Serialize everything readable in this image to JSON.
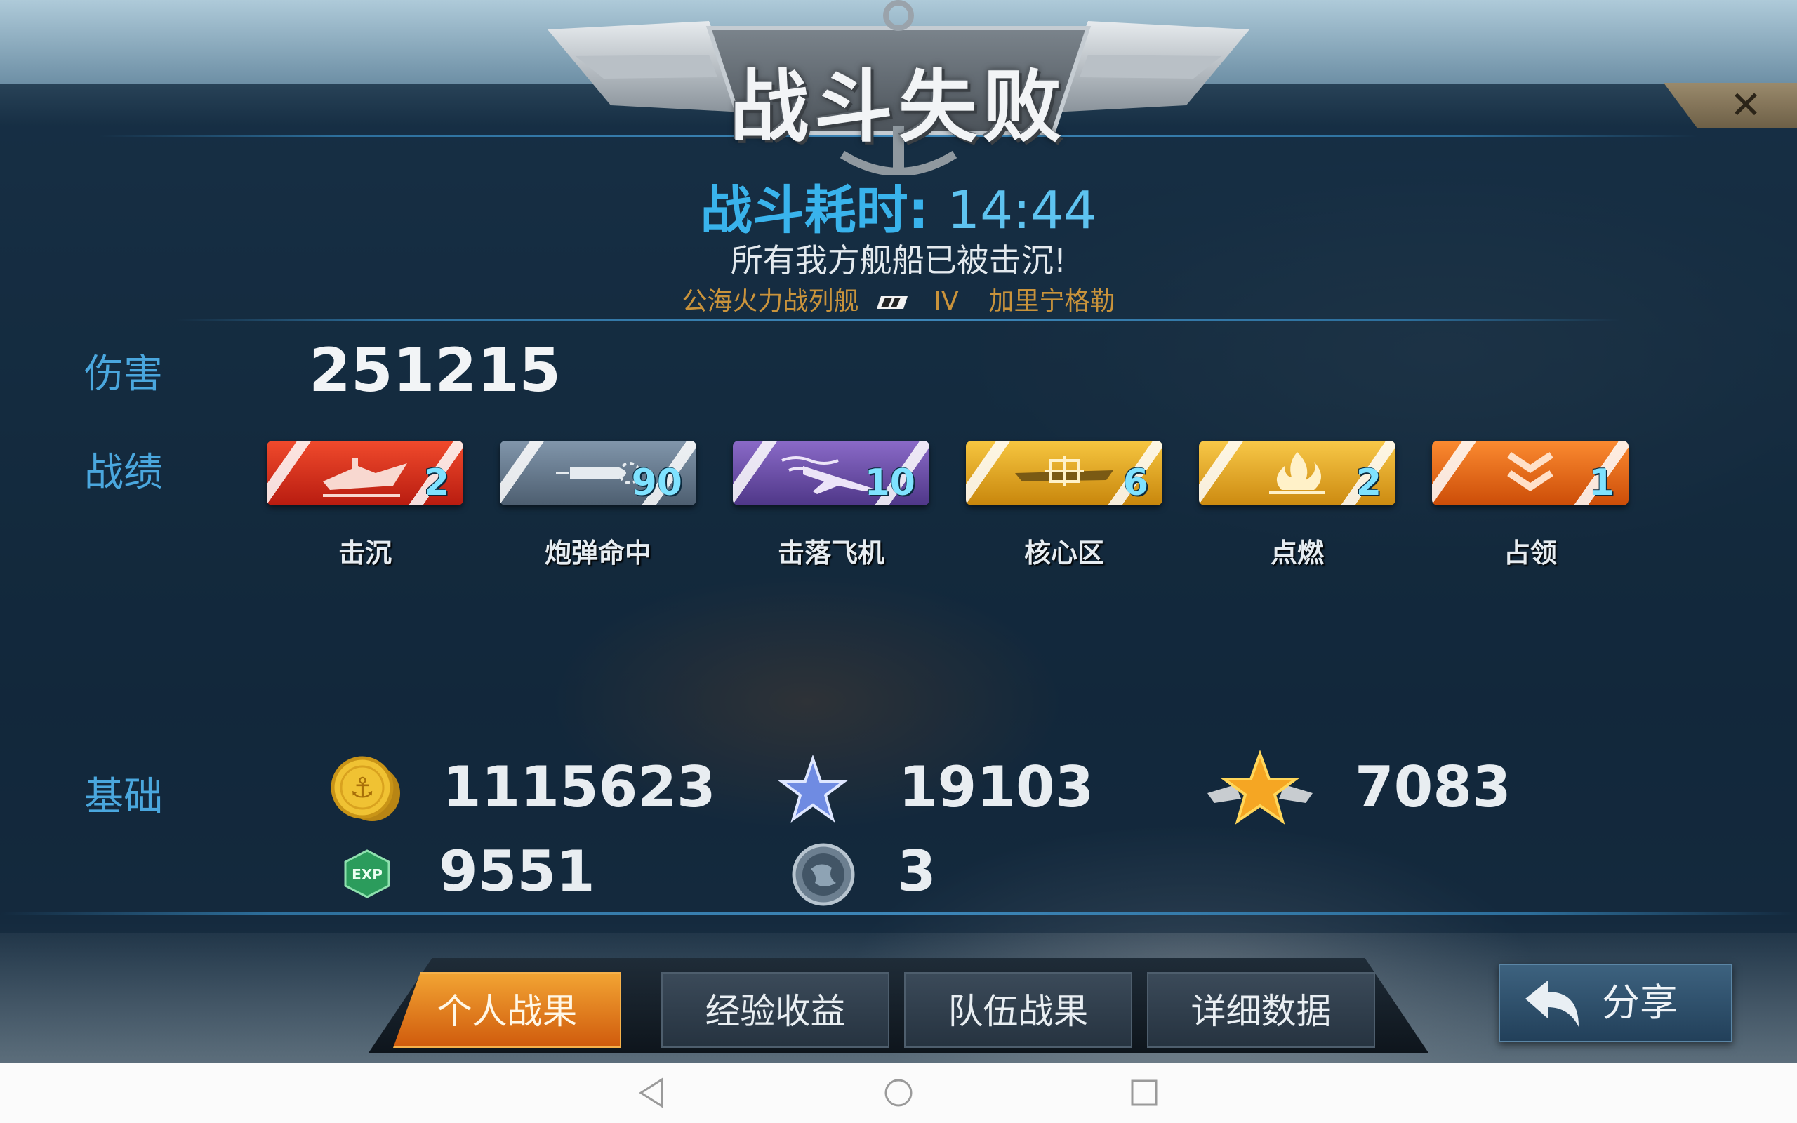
{
  "header": {
    "title": "战斗失败"
  },
  "battle": {
    "time_label": "战斗耗时:",
    "time_value": "14:44",
    "message": "所有我方舰船已被击沉!",
    "mode": "公海火力战列舰",
    "tier": "IV",
    "ship": "加里宁格勒"
  },
  "damage": {
    "label": "伤害",
    "value": "251215"
  },
  "record": {
    "label": "战绩",
    "items": [
      {
        "name": "击沉",
        "count": "2",
        "color": "#d62a1a",
        "icon": "sinking-ship-icon"
      },
      {
        "name": "炮弹命中",
        "count": "90",
        "color": "#5d6f83",
        "icon": "shell-icon"
      },
      {
        "name": "击落飞机",
        "count": "10",
        "color": "#6a4fa6",
        "icon": "plane-down-icon"
      },
      {
        "name": "核心区",
        "count": "6",
        "color": "#e0a41c",
        "icon": "citadel-icon"
      },
      {
        "name": "点燃",
        "count": "2",
        "color": "#e6a51f",
        "icon": "fire-icon"
      },
      {
        "name": "占领",
        "count": "1",
        "color": "#ec6b18",
        "icon": "capture-chevron-icon"
      }
    ]
  },
  "base": {
    "label": "基础",
    "silver": "1115623",
    "star_points": "19103",
    "medal_points": "7083",
    "exp": "9551",
    "globe": "3",
    "exp_icon_text": "EXP"
  },
  "tabs": [
    {
      "label": "个人战果",
      "active": true
    },
    {
      "label": "经验收益",
      "active": false
    },
    {
      "label": "队伍战果",
      "active": false
    },
    {
      "label": "详细数据",
      "active": false
    }
  ],
  "share": {
    "label": "分享"
  }
}
